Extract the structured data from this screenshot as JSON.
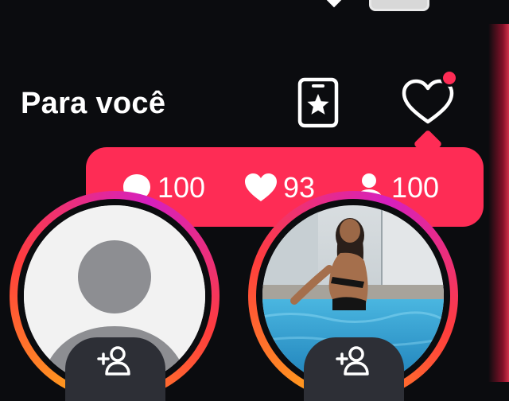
{
  "header": {
    "title": "Para você",
    "live_card_icon": "star-card-icon",
    "activity_icon": "heart-outline-icon"
  },
  "tooltip": {
    "stats": [
      {
        "icon": "comment-icon",
        "value": "100"
      },
      {
        "icon": "heart-icon",
        "value": "93"
      },
      {
        "icon": "person-icon",
        "value": "100"
      }
    ],
    "color": "#fe2c55"
  },
  "stories": [
    {
      "avatar": "default-avatar-placeholder",
      "follow_icon": "add-user-icon"
    },
    {
      "avatar": "user-photo-pool",
      "follow_icon": "add-user-icon"
    }
  ],
  "colors": {
    "background": "#0b0c0f",
    "accent": "#fe2c55",
    "ring_gradient": [
      "#ff9f1c",
      "#ff3d3d",
      "#d61fbf"
    ]
  }
}
